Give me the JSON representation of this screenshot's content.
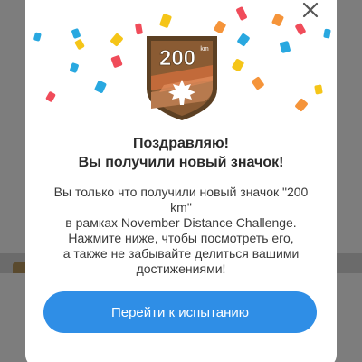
{
  "badge": {
    "distance": "200",
    "unit": "km"
  },
  "modal": {
    "title_line1": "Поздравляю!",
    "title_line2": "Вы получили новый значок!",
    "body_line1": "Вы только что получили новый значок \"200",
    "body_line2": "km\"",
    "body_line3": "в рамках November Distance Challenge.",
    "body_line4": "Нажмите ниже, чтобы посмотреть его,",
    "body_line5": "а также не забывайте делиться вашими",
    "body_line6": "достижениями!",
    "cta_label": "Перейти к испытанию"
  },
  "colors": {
    "accent": "#2f8ee6",
    "badge_border": "#5c4023",
    "badge_fill": "#8a5b33",
    "confetti_yellow": "#f5c518",
    "confetti_red": "#f04c5a",
    "confetti_blue": "#29a8e0",
    "confetti_orange": "#f5943a"
  },
  "icons": {
    "close": "close-icon",
    "badge": "maple-leaf-badge"
  }
}
